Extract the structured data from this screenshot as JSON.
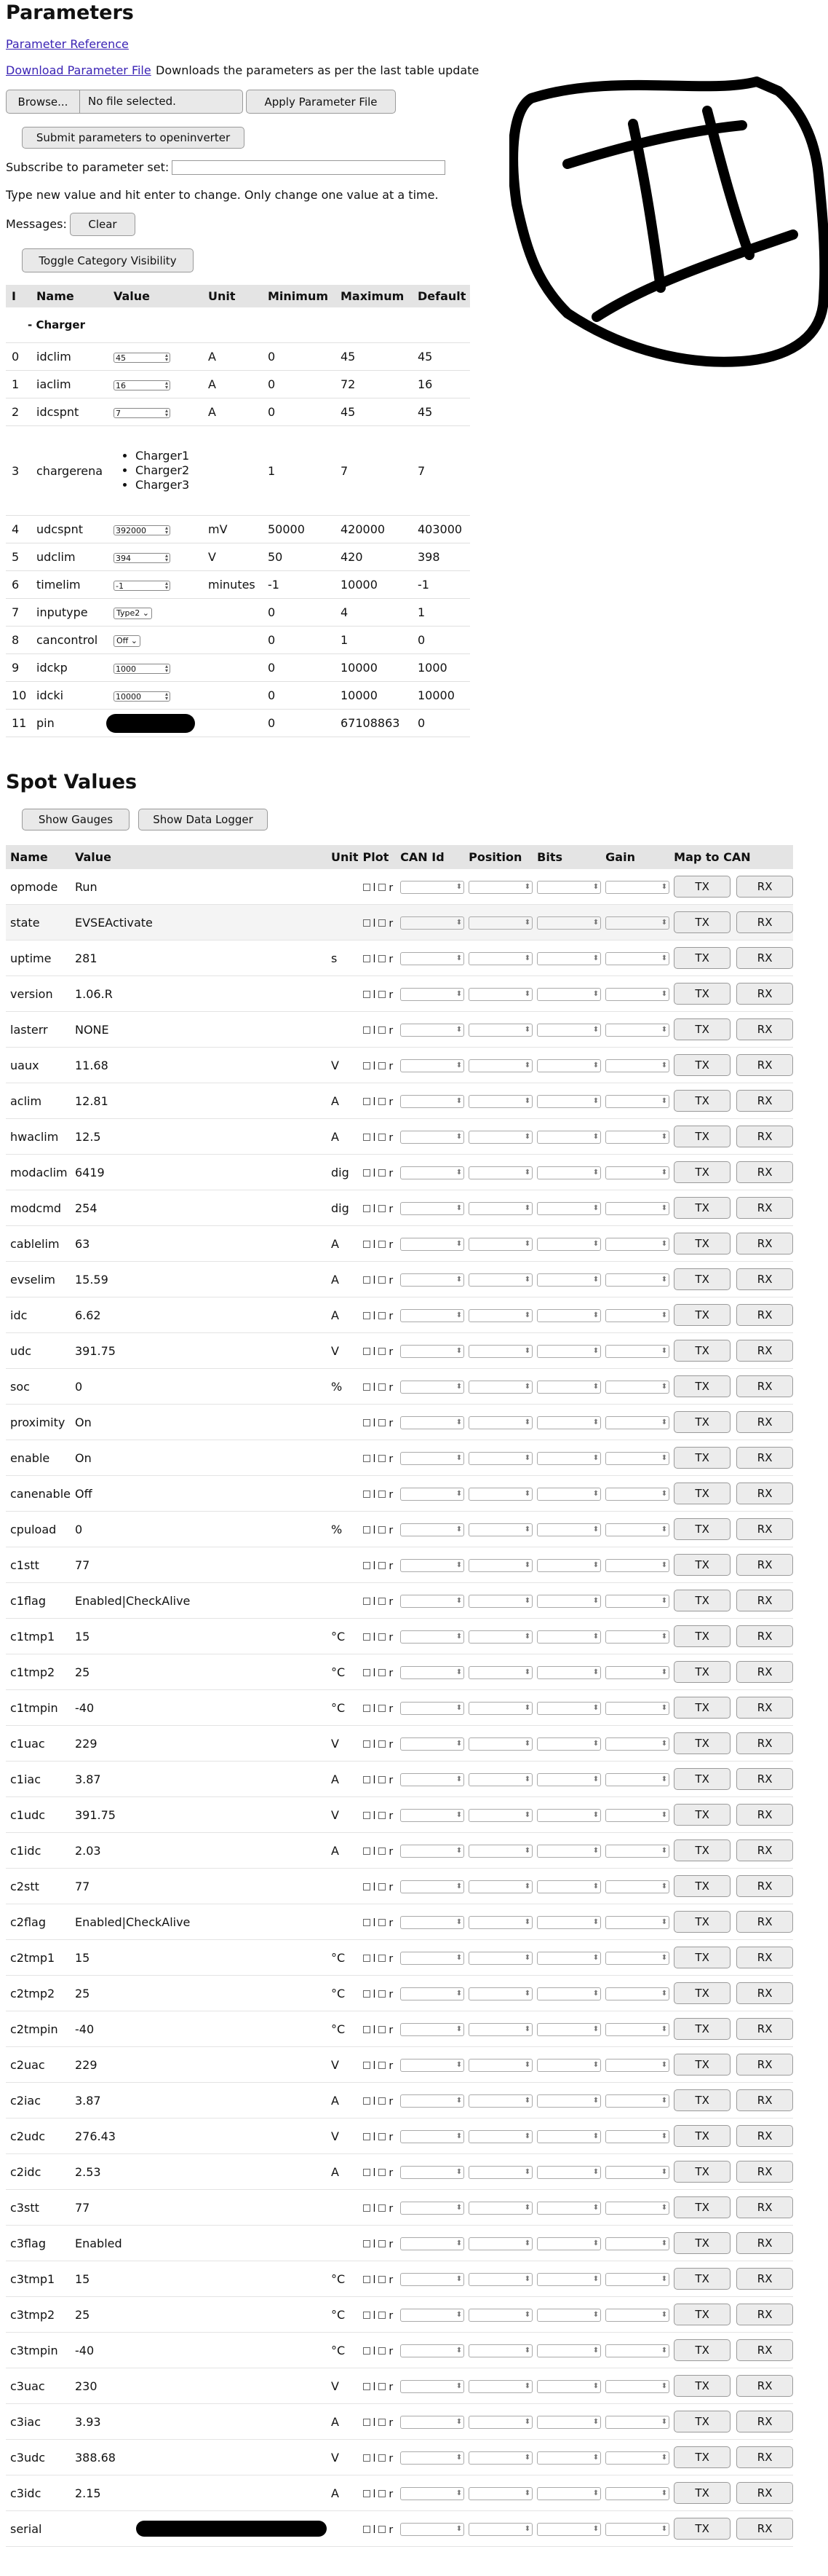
{
  "page": {
    "title": "Parameters",
    "param_ref_link": "Parameter Reference",
    "download_link": "Download Parameter File",
    "download_desc": "Downloads the parameters as per the last table update",
    "browse_label": "Browse...",
    "file_status": "No file selected.",
    "apply_label": "Apply Parameter File",
    "submit_label": "Submit parameters to openinverter",
    "subscribe_label": "Subscribe to parameter set:",
    "subscribe_value": "",
    "hint": "Type new value and hit enter to change. Only change one value at a time.",
    "messages_label": "Messages:",
    "clear_label": "Clear",
    "toggle_label": "Toggle Category Visibility"
  },
  "params": {
    "headers": [
      "I",
      "Name",
      "Value",
      "Unit",
      "Minimum",
      "Maximum",
      "Default"
    ],
    "category": "- Charger",
    "rows": [
      {
        "i": "0",
        "name": "idclim",
        "value": "45",
        "kind": "num",
        "unit": "A",
        "min": "0",
        "max": "45",
        "def": "45"
      },
      {
        "i": "1",
        "name": "iaclim",
        "value": "16",
        "kind": "num",
        "unit": "A",
        "min": "0",
        "max": "72",
        "def": "16"
      },
      {
        "i": "2",
        "name": "idcspnt",
        "value": "7",
        "kind": "num",
        "unit": "A",
        "min": "0",
        "max": "45",
        "def": "45"
      },
      {
        "i": "3",
        "name": "chargerena",
        "value": "",
        "kind": "list",
        "items": [
          "Charger1",
          "Charger2",
          "Charger3"
        ],
        "unit": "",
        "min": "1",
        "max": "7",
        "def": "7"
      },
      {
        "i": "4",
        "name": "udcspnt",
        "value": "392000",
        "kind": "num",
        "unit": "mV",
        "min": "50000",
        "max": "420000",
        "def": "403000"
      },
      {
        "i": "5",
        "name": "udclim",
        "value": "394",
        "kind": "num",
        "unit": "V",
        "min": "50",
        "max": "420",
        "def": "398"
      },
      {
        "i": "6",
        "name": "timelim",
        "value": "-1",
        "kind": "num",
        "unit": "minutes",
        "min": "-1",
        "max": "10000",
        "def": "-1"
      },
      {
        "i": "7",
        "name": "inputype",
        "value": "Type2",
        "kind": "select",
        "unit": "",
        "min": "0",
        "max": "4",
        "def": "1"
      },
      {
        "i": "8",
        "name": "cancontrol",
        "value": "Off",
        "kind": "select",
        "unit": "",
        "min": "0",
        "max": "1",
        "def": "0"
      },
      {
        "i": "9",
        "name": "idckp",
        "value": "1000",
        "kind": "num",
        "unit": "",
        "min": "0",
        "max": "10000",
        "def": "1000"
      },
      {
        "i": "10",
        "name": "idcki",
        "value": "10000",
        "kind": "num",
        "unit": "",
        "min": "0",
        "max": "10000",
        "def": "10000"
      },
      {
        "i": "11",
        "name": "pin",
        "value": "",
        "kind": "redacted",
        "unit": "",
        "min": "0",
        "max": "67108863",
        "def": "0"
      }
    ]
  },
  "spot": {
    "title": "Spot Values",
    "show_gauges": "Show Gauges",
    "show_logger": "Show Data Logger",
    "headers": [
      "Name",
      "Value",
      "Unit",
      "Plot",
      "CAN Id",
      "Position",
      "Bits",
      "Gain",
      "Map to CAN"
    ],
    "plot_l": "l",
    "plot_r": "r",
    "tx": "TX",
    "rx": "RX",
    "rows": [
      {
        "name": "opmode",
        "value": "Run",
        "unit": ""
      },
      {
        "name": "state",
        "value": "EVSEActivate",
        "unit": ""
      },
      {
        "name": "uptime",
        "value": "281",
        "unit": "s"
      },
      {
        "name": "version",
        "value": "1.06.R",
        "unit": ""
      },
      {
        "name": "lasterr",
        "value": "NONE",
        "unit": ""
      },
      {
        "name": "uaux",
        "value": "11.68",
        "unit": "V"
      },
      {
        "name": "aclim",
        "value": "12.81",
        "unit": "A"
      },
      {
        "name": "hwaclim",
        "value": "12.5",
        "unit": "A"
      },
      {
        "name": "modaclim",
        "value": "6419",
        "unit": "dig"
      },
      {
        "name": "modcmd",
        "value": "254",
        "unit": "dig"
      },
      {
        "name": "cablelim",
        "value": "63",
        "unit": "A"
      },
      {
        "name": "evselim",
        "value": "15.59",
        "unit": "A"
      },
      {
        "name": "idc",
        "value": "6.62",
        "unit": "A"
      },
      {
        "name": "udc",
        "value": "391.75",
        "unit": "V"
      },
      {
        "name": "soc",
        "value": "0",
        "unit": "%"
      },
      {
        "name": "proximity",
        "value": "On",
        "unit": ""
      },
      {
        "name": "enable",
        "value": "On",
        "unit": ""
      },
      {
        "name": "canenable",
        "value": "Off",
        "unit": ""
      },
      {
        "name": "cpuload",
        "value": "0",
        "unit": "%"
      },
      {
        "name": "c1stt",
        "value": "77",
        "unit": ""
      },
      {
        "name": "c1flag",
        "value": "Enabled|CheckAlive",
        "unit": ""
      },
      {
        "name": "c1tmp1",
        "value": "15",
        "unit": "°C"
      },
      {
        "name": "c1tmp2",
        "value": "25",
        "unit": "°C"
      },
      {
        "name": "c1tmpin",
        "value": "-40",
        "unit": "°C"
      },
      {
        "name": "c1uac",
        "value": "229",
        "unit": "V"
      },
      {
        "name": "c1iac",
        "value": "3.87",
        "unit": "A"
      },
      {
        "name": "c1udc",
        "value": "391.75",
        "unit": "V"
      },
      {
        "name": "c1idc",
        "value": "2.03",
        "unit": "A"
      },
      {
        "name": "c2stt",
        "value": "77",
        "unit": ""
      },
      {
        "name": "c2flag",
        "value": "Enabled|CheckAlive",
        "unit": ""
      },
      {
        "name": "c2tmp1",
        "value": "15",
        "unit": "°C"
      },
      {
        "name": "c2tmp2",
        "value": "25",
        "unit": "°C"
      },
      {
        "name": "c2tmpin",
        "value": "-40",
        "unit": "°C"
      },
      {
        "name": "c2uac",
        "value": "229",
        "unit": "V"
      },
      {
        "name": "c2iac",
        "value": "3.87",
        "unit": "A"
      },
      {
        "name": "c2udc",
        "value": "276.43",
        "unit": "V"
      },
      {
        "name": "c2idc",
        "value": "2.53",
        "unit": "A"
      },
      {
        "name": "c3stt",
        "value": "77",
        "unit": ""
      },
      {
        "name": "c3flag",
        "value": "Enabled",
        "unit": ""
      },
      {
        "name": "c3tmp1",
        "value": "15",
        "unit": "°C"
      },
      {
        "name": "c3tmp2",
        "value": "25",
        "unit": "°C"
      },
      {
        "name": "c3tmpin",
        "value": "-40",
        "unit": "°C"
      },
      {
        "name": "c3uac",
        "value": "230",
        "unit": "V"
      },
      {
        "name": "c3iac",
        "value": "3.93",
        "unit": "A"
      },
      {
        "name": "c3udc",
        "value": "388.68",
        "unit": "V"
      },
      {
        "name": "c3idc",
        "value": "2.15",
        "unit": "A"
      },
      {
        "name": "serial",
        "value": "",
        "unit": "",
        "redacted": true
      }
    ]
  }
}
